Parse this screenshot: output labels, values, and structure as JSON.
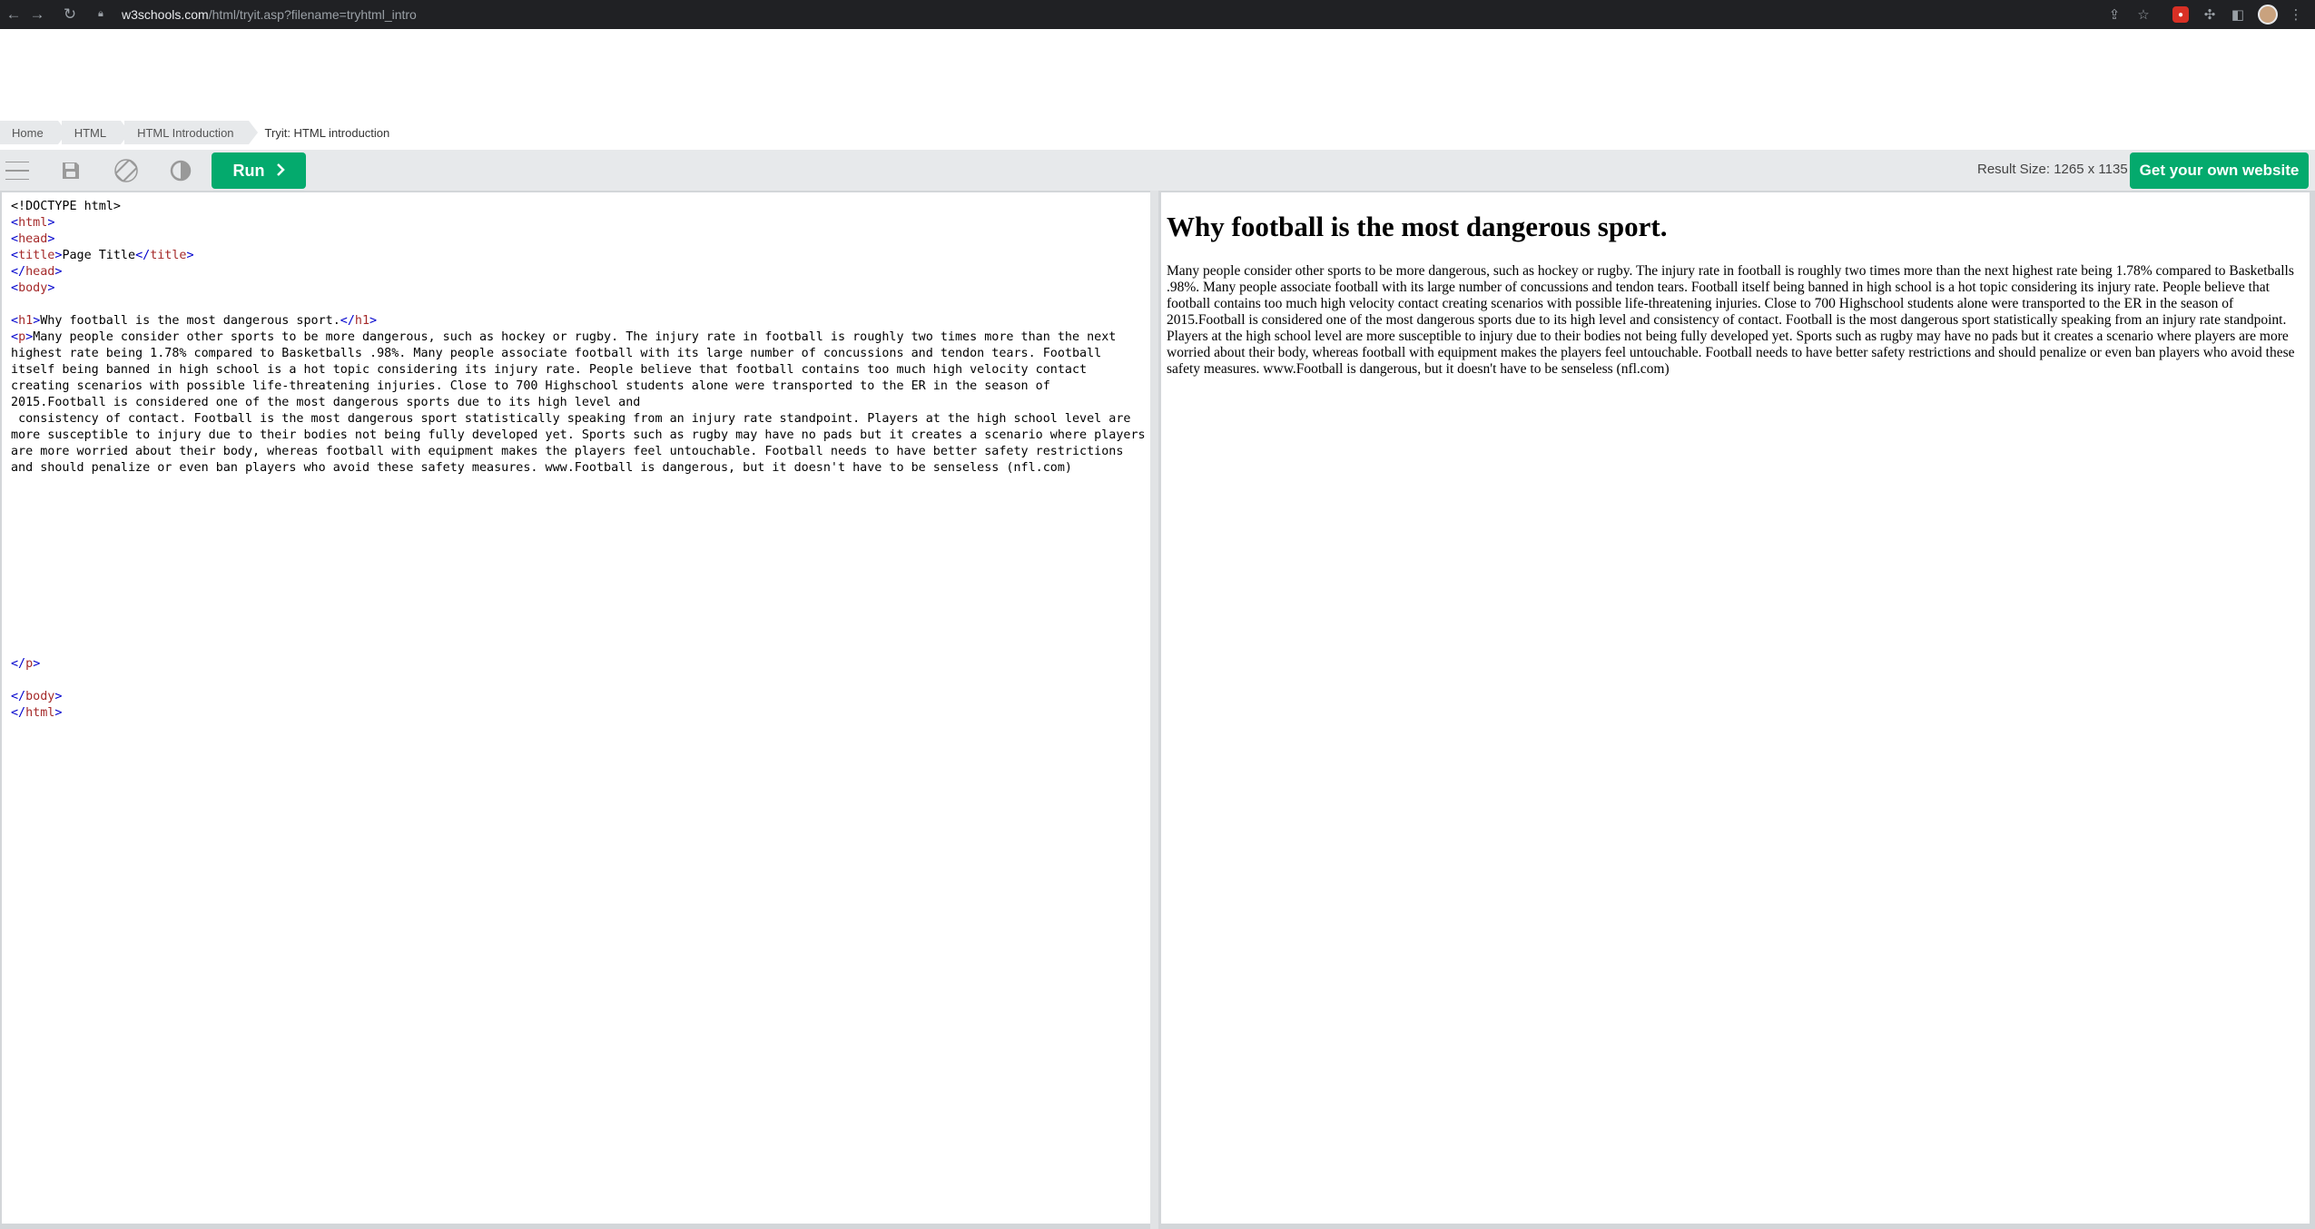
{
  "browser": {
    "url_host": "w3schools.com",
    "url_path": "/html/tryit.asp?filename=tryhtml_intro"
  },
  "breadcrumb": [
    "Home",
    "HTML",
    "HTML Introduction",
    "Tryit: HTML introduction"
  ],
  "toolbar": {
    "run_label": "Run",
    "result_size": "Result Size: 1265 x 1135",
    "own_site_label": "Get your own website"
  },
  "editor": {
    "lines": [
      {
        "type": "plain",
        "text": "<!DOCTYPE html>"
      },
      {
        "type": "tag",
        "text": "html"
      },
      {
        "type": "tag",
        "text": "head"
      },
      {
        "type": "title",
        "text": "Page Title"
      },
      {
        "type": "endtag",
        "text": "head"
      },
      {
        "type": "tag",
        "text": "body"
      },
      {
        "type": "blank",
        "text": ""
      },
      {
        "type": "h1",
        "text": "Why football is the most dangerous sport."
      },
      {
        "type": "p",
        "text": "Many people consider other sports to be more dangerous, such as hockey or rugby. The injury rate in football is roughly two times more than the next highest rate being 1.78% compared to Basketballs .98%. Many people associate football with its large number of concussions and tendon tears. Football itself being banned in high school is a hot topic considering its injury rate. People believe that football contains too much high velocity contact creating scenarios with possible life-threatening injuries. Close to 700 Highschool students alone were transported to the ER in the season of 2015.Football is considered one of the most dangerous sports due to its high level and"
      },
      {
        "type": "plain",
        "text": " consistency of contact. Football is the most dangerous sport statistically speaking from an injury rate standpoint. Players at the high school level are more susceptible to injury due to their bodies not being fully developed yet. Sports such as rugby may have no pads but it creates a scenario where players are more worried about their body, whereas football with equipment makes the players feel untouchable. Football needs to have better safety restrictions and should penalize or even ban players who avoid these safety measures. www.Football is dangerous, but it doesn't have to be senseless (nfl.com)"
      },
      {
        "type": "blank",
        "text": ""
      },
      {
        "type": "blank",
        "text": ""
      },
      {
        "type": "blank",
        "text": ""
      },
      {
        "type": "blank",
        "text": ""
      },
      {
        "type": "blank",
        "text": ""
      },
      {
        "type": "blank",
        "text": ""
      },
      {
        "type": "blank",
        "text": ""
      },
      {
        "type": "blank",
        "text": ""
      },
      {
        "type": "blank",
        "text": ""
      },
      {
        "type": "blank",
        "text": ""
      },
      {
        "type": "blank",
        "text": ""
      },
      {
        "type": "endtag",
        "text": "p"
      },
      {
        "type": "blank",
        "text": ""
      },
      {
        "type": "endtag",
        "text": "body"
      },
      {
        "type": "endtag",
        "text": "html"
      }
    ]
  },
  "result": {
    "heading": "Why football is the most dangerous sport.",
    "paragraph": "Many people consider other sports to be more dangerous, such as hockey or rugby. The injury rate in football is roughly two times more than the next highest rate being 1.78% compared to Basketballs .98%. Many people associate football with its large number of concussions and tendon tears. Football itself being banned in high school is a hot topic considering its injury rate. People believe that football contains too much high velocity contact creating scenarios with possible life-threatening injuries. Close to 700 Highschool students alone were transported to the ER in the season of 2015.Football is considered one of the most dangerous sports due to its high level and consistency of contact. Football is the most dangerous sport statistically speaking from an injury rate standpoint. Players at the high school level are more susceptible to injury due to their bodies not being fully developed yet. Sports such as rugby may have no pads but it creates a scenario where players are more worried about their body, whereas football with equipment makes the players feel untouchable. Football needs to have better safety restrictions and should penalize or even ban players who avoid these safety measures. www.Football is dangerous, but it doesn't have to be senseless (nfl.com)"
  },
  "colors": {
    "accent": "#04aa6d",
    "tag": "#a52a2a",
    "bracket": "#0000cd"
  }
}
